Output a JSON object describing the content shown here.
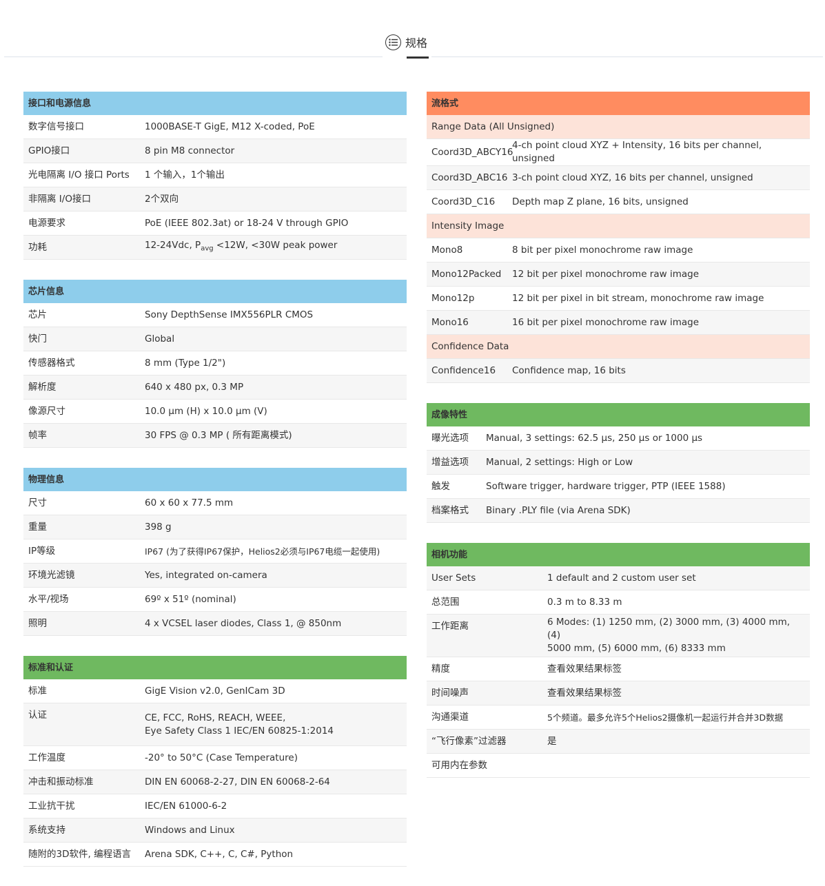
{
  "page_header": {
    "icon": "list-icon",
    "title": "规格"
  },
  "left_tables": [
    {
      "header": "接口和电源信息",
      "color": "#8ecdeb",
      "rows": [
        [
          "数字信号接口",
          "1000BASE-T GigE, M12 X-coded, PoE"
        ],
        [
          "GPIO接口",
          "8 pin M8 connector"
        ],
        [
          "光电隔离 I/O 接口 Ports",
          "1 个输入，1个输出"
        ],
        [
          "非隔离 I/O接口",
          "2个双向"
        ],
        [
          "电源要求",
          "PoE (IEEE 802.3at) or 18-24 V through GPIO"
        ],
        [
          "功耗",
          "12-24Vdc, P",
          "avg",
          " <12W, <30W peak power"
        ]
      ]
    },
    {
      "header": "芯片信息",
      "color": "#8ecdeb",
      "rows": [
        [
          "芯片",
          "Sony DepthSense IMX556PLR CMOS"
        ],
        [
          "快门",
          "Global"
        ],
        [
          "传感器格式",
          "8 mm (Type 1/2\")"
        ],
        [
          "解析度",
          "640 x 480 px, 0.3 MP"
        ],
        [
          "像源尺寸",
          "10.0 µm (H) x 10.0 µm (V)"
        ],
        [
          "帧率",
          "30 FPS @ 0.3 MP ( 所有距离模式)"
        ]
      ]
    },
    {
      "header": "物理信息",
      "color": "#8ecdeb",
      "rows": [
        [
          "尺寸",
          "60 x 60 x 77.5 mm"
        ],
        [
          "重量",
          "398 g"
        ],
        [
          "IP等级",
          "IP67 (为了获得IP67保护，Helios2必须与IP67电缆一起使用)"
        ],
        [
          "环境光滤镜",
          "Yes, integrated on-camera"
        ],
        [
          "水平/视场",
          "69º x 51º (nominal)"
        ],
        [
          "照明",
          "4 x VCSEL laser diodes, Class 1, @ 850nm"
        ]
      ]
    },
    {
      "header": "标准和认证",
      "color": "#6fb960",
      "rows": [
        [
          "标准",
          "GigE Vision v2.0, GenICam 3D"
        ],
        [
          "认证",
          "CE, FCC, RoHS, REACH, WEEE,",
          "Eye Safety Class 1 IEC/EN 60825-1:2014"
        ],
        [
          "工作温度",
          "-20° to 50°C (Case Temperature)"
        ],
        [
          "冲击和振动标准",
          "DIN EN 60068-2-27, DIN EN 60068-2-64"
        ],
        [
          "工业抗干扰",
          "IEC/EN 61000-6-2"
        ],
        [
          "系统支持",
          "Windows and Linux"
        ],
        [
          "随附的3D软件, 编程语言",
          "Arena SDK, C++, C, C#, Python"
        ]
      ]
    }
  ],
  "stream_table": {
    "header": "流格式",
    "color": "#ff8c60",
    "sub_color": "#fde3d9",
    "rows": [
      [
        "Range Data (All Unsigned)"
      ],
      [
        "Coord3D_ABCY16",
        "4-ch point cloud XYZ + Intensity, 16 bits per channel, unsigned"
      ],
      [
        "Coord3D_ABC16",
        "3-ch point cloud XYZ, 16 bits per channel, unsigned"
      ],
      [
        "Coord3D_C16",
        "Depth map Z plane, 16 bits, unsigned"
      ],
      [
        "Intensity Image"
      ],
      [
        "Mono8",
        "8 bit per pixel monochrome raw image"
      ],
      [
        "Mono12Packed",
        "12 bit per pixel monochrome raw image"
      ],
      [
        "Mono12p",
        "12 bit per pixel in bit stream, monochrome raw image"
      ],
      [
        "Mono16",
        "16 bit per pixel monochrome raw image"
      ],
      [
        "Confidence Data"
      ],
      [
        "Confidence16",
        "Confidence map, 16 bits"
      ]
    ]
  },
  "imaging_table": {
    "header": "成像特性",
    "color": "#6fb960",
    "rows": [
      [
        "曝光选项",
        "Manual, 3 settings: 62.5 µs, 250 µs or 1000 µs"
      ],
      [
        "增益选项",
        "Manual, 2 settings: High or Low"
      ],
      [
        "触发",
        "Software trigger, hardware trigger, PTP (IEEE 1588)"
      ],
      [
        "档案格式",
        "Binary .PLY file (via Arena SDK)"
      ]
    ]
  },
  "camera_table": {
    "header": "相机功能",
    "color": "#6fb960",
    "rows": [
      [
        "User Sets",
        "1 default and 2 custom user set"
      ],
      [
        "总范围",
        "0.3 m to 8.33 m"
      ],
      [
        "工作距离",
        "6 Modes: (1) 1250 mm, (2) 3000 mm, (3) 4000 mm, (4)",
        "5000 mm, (5) 6000 mm, (6) 8333 mm"
      ],
      [
        "精度",
        "查看效果结果标签"
      ],
      [
        "时间噪声",
        "查看效果结果标签"
      ],
      [
        "沟通渠道",
        "5个频道。最多允许5个Helios2摄像机一起运行并合并3D数据"
      ],
      [
        "“飞行像素”过滤器",
        "是"
      ],
      [
        "可用内在参数",
        ""
      ]
    ]
  }
}
